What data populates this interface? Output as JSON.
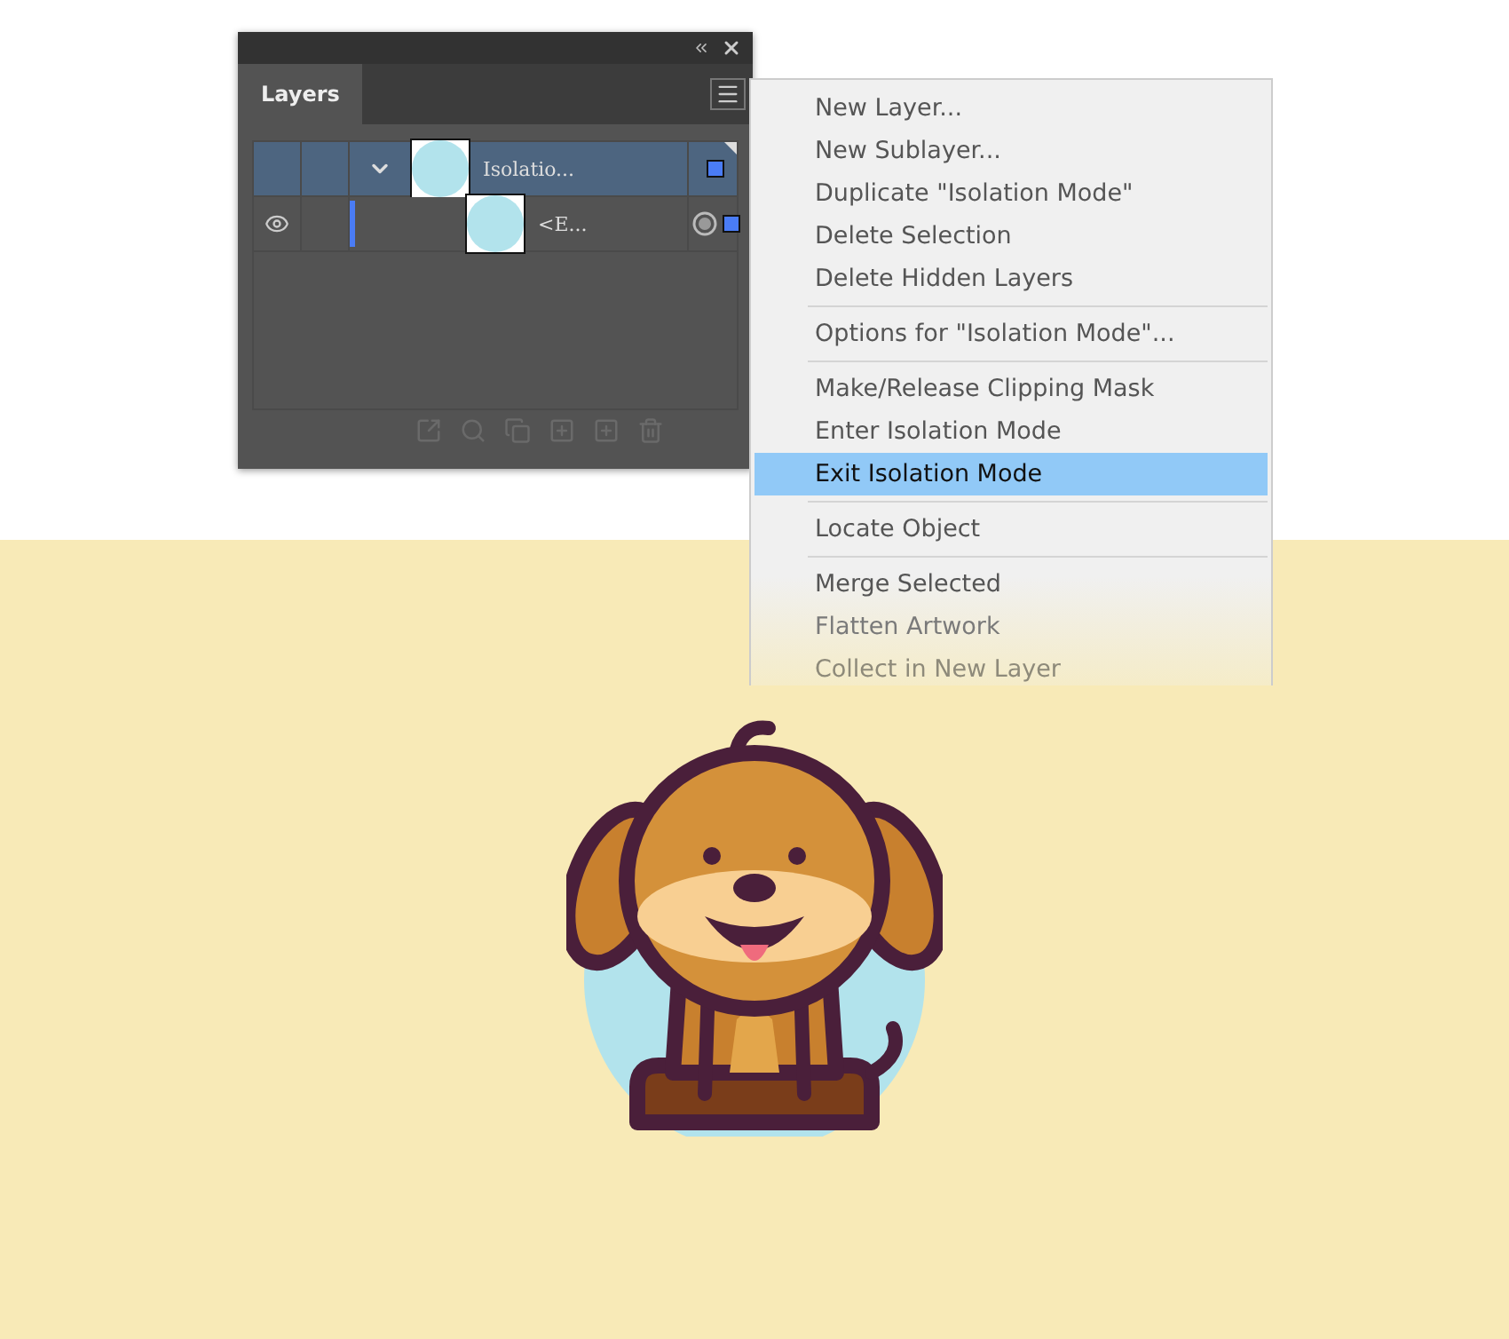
{
  "panel": {
    "tab": {
      "label": "Layers",
      "selected": true
    },
    "rows": [
      {
        "kind": "group",
        "name": "Isolatio...",
        "visible": false,
        "selected": true,
        "expanded": true
      },
      {
        "kind": "path",
        "name": "<E...",
        "visible": true,
        "selected": false
      }
    ]
  },
  "menu": {
    "groups": [
      [
        {
          "label": "New Layer...",
          "selected": false
        },
        {
          "label": "New Sublayer...",
          "selected": false
        },
        {
          "label": "Duplicate \"Isolation Mode\"",
          "selected": false
        },
        {
          "label": "Delete Selection",
          "selected": false
        },
        {
          "label": "Delete Hidden Layers",
          "selected": false
        }
      ],
      [
        {
          "label": "Options for \"Isolation Mode\"...",
          "selected": false
        }
      ],
      [
        {
          "label": "Make/Release Clipping Mask",
          "selected": false
        },
        {
          "label": "Enter Isolation Mode",
          "selected": false
        },
        {
          "label": "Exit Isolation Mode",
          "selected": true
        }
      ],
      [
        {
          "label": "Locate Object",
          "selected": false
        }
      ],
      [
        {
          "label": "Merge Selected",
          "selected": false
        },
        {
          "label": "Flatten Artwork",
          "selected": false
        },
        {
          "label": "Collect in New Layer",
          "selected": false
        }
      ]
    ]
  }
}
